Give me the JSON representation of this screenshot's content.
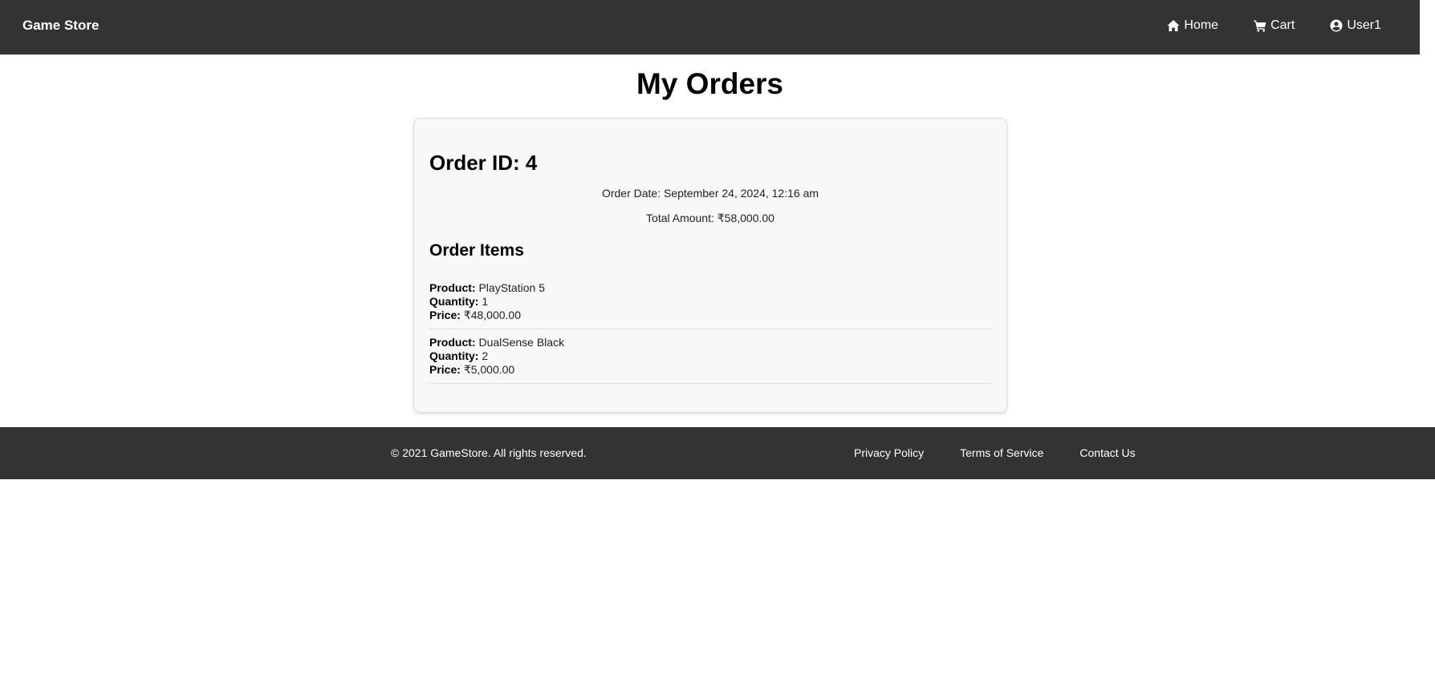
{
  "navbar": {
    "brand": "Game Store",
    "links": [
      {
        "label": "Home",
        "icon": "home-icon"
      },
      {
        "label": "Cart",
        "icon": "cart-icon"
      },
      {
        "label": "User1",
        "icon": "user-circle-icon"
      }
    ]
  },
  "page": {
    "title": "My Orders"
  },
  "order": {
    "id_label": "Order ID: 4",
    "date_text": "Order Date: September 24, 2024, 12:16 am",
    "total_text": "Total Amount: ₹58,000.00",
    "items_heading": "Order Items",
    "labels": {
      "product": "Product:",
      "quantity": "Quantity:",
      "price": "Price:"
    },
    "items": [
      {
        "product": "PlayStation 5",
        "quantity": "1",
        "price": "₹48,000.00"
      },
      {
        "product": "DualSense Black",
        "quantity": "2",
        "price": "₹5,000.00"
      }
    ]
  },
  "footer": {
    "copyright": "© 2021 GameStore. All rights reserved.",
    "links": [
      "Privacy Policy",
      "Terms of Service",
      "Contact Us"
    ]
  },
  "colors": {
    "bar": "#333333",
    "card_bg": "#f8f8f8",
    "divider": "#dddddd"
  }
}
